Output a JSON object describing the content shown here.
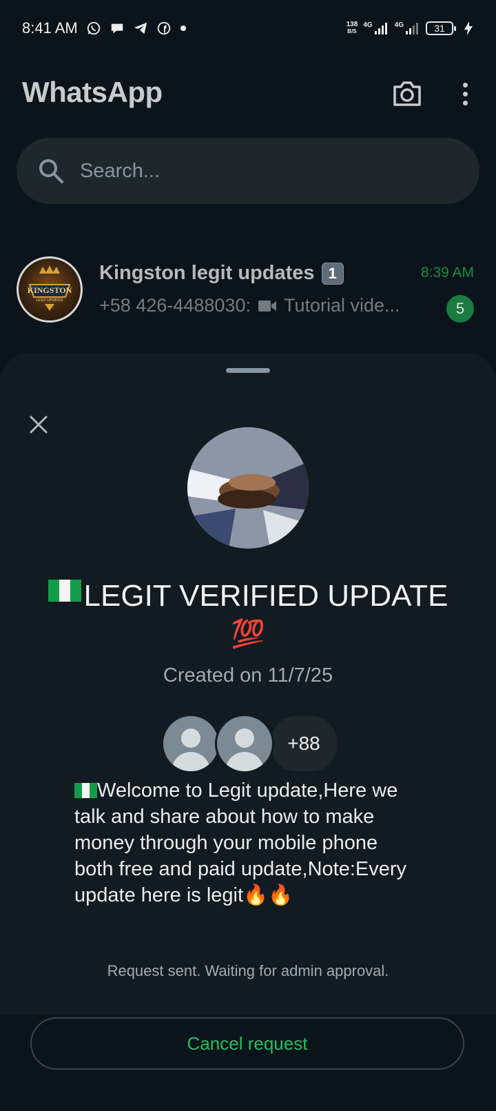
{
  "status_bar": {
    "time": "8:41 AM",
    "net_speed_value": "138",
    "net_speed_unit": "B/S",
    "network_1": "4G",
    "network_2": "4G",
    "battery": "31"
  },
  "header": {
    "title": "WhatsApp"
  },
  "search": {
    "placeholder": "Search..."
  },
  "chat": {
    "name": "Kingston legit updates",
    "name_badge": "1",
    "time": "8:39 AM",
    "preview_sender": "+58 426-4488030:",
    "preview_text": "Tutorial vide...",
    "unread_count": "5",
    "avatar_text": "KINGSTON",
    "avatar_subtext": "LEGIT UPDATES"
  },
  "sheet": {
    "title": "LEGIT VERIFIED UPDATE",
    "title_emoji": "💯",
    "created": "Created on 11/7/25",
    "more_members": "+88",
    "description": "Welcome to Legit update,Here we talk and share about how to make money through your mobile phone both free and paid update,Note:Every update here is legit",
    "description_emoji": "🔥🔥",
    "request_status": "Request sent. Waiting for admin approval.",
    "cancel_label": "Cancel request"
  },
  "colors": {
    "accent_green": "#21c063",
    "background": "#0b141a",
    "sheet": "#121b21"
  }
}
